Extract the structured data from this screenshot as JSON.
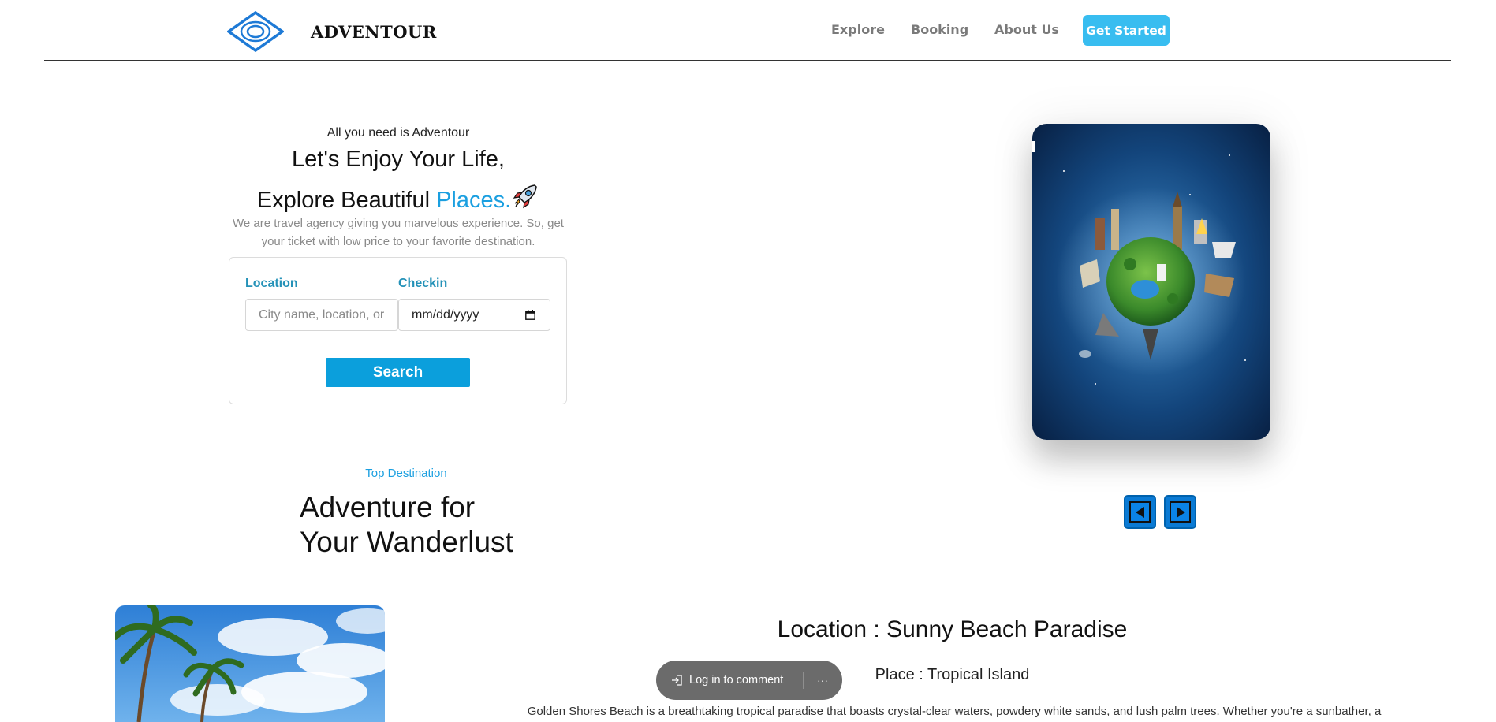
{
  "header": {
    "brand": "ADVENTOUR",
    "nav": {
      "explore": "Explore",
      "booking": "Booking",
      "about": "About Us"
    },
    "cta": "Get Started",
    "logo_icon": "eye-diamond-logo"
  },
  "hero": {
    "tagline": "All you need is Adventour",
    "title_line1": "Let's Enjoy Your Life,",
    "title_line2_prefix": "Explore Beautiful ",
    "title_line2_accent": "Places.",
    "emoji": "rocket-icon",
    "description_line1": "We are travel agency giving you marvelous experience. So, get",
    "description_line2": "your ticket with low price to your favorite destination."
  },
  "search": {
    "location_label": "Location",
    "location_placeholder": "City name, location, or",
    "checkin_label": "Checkin",
    "checkin_value": "mm/dd/yyyy",
    "button": "Search"
  },
  "carousel": {
    "prev_icon": "left-arrow-icon",
    "next_icon": "right-arrow-icon"
  },
  "destinations": {
    "eyebrow": "Top Destination",
    "title_line1": "Adventure for",
    "title_line2": "Your Wanderlust",
    "item": {
      "location": "Location : Sunny Beach Paradise",
      "place": "Place : Tropical Island",
      "description": "Golden Shores Beach is a breathtaking tropical paradise that boasts crystal-clear waters, powdery white sands, and lush palm trees. Whether you're a sunbather, a"
    }
  },
  "comment": {
    "label": "Log in to comment",
    "more": "···"
  },
  "colors": {
    "accent": "#1a9fe0",
    "cta": "#38bdf0",
    "search_button": "#0b9fdc",
    "label": "#2592b8"
  }
}
